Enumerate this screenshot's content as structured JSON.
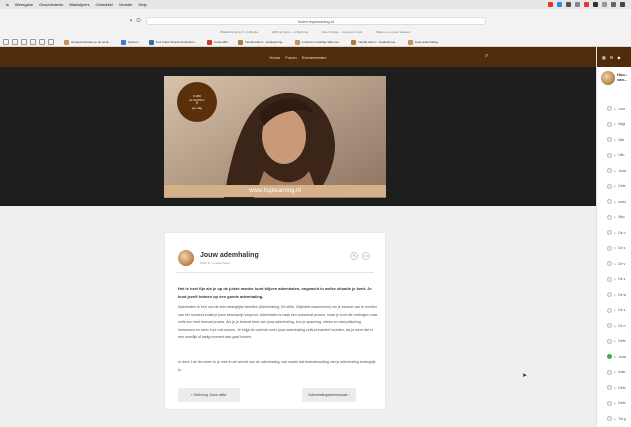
{
  "menubar": {
    "items": [
      "ls",
      "Weergave",
      "Geschiedenis",
      "Bladwijzers",
      "Ontwikkel",
      "Venster",
      "Help"
    ]
  },
  "browser": {
    "url": "leden.hsplearning.nl",
    "bookmarks": [
      "Bhaskil Ending, Fr Umbrella",
      "HRP-teit (Em. + & Buccina)",
      "Roun Starte ... ossed en hotel",
      "Taksen en, oroan takesen"
    ],
    "tabs": [
      "Hoogsensitiviteit op de werk...",
      "Openen",
      "Tool Class Simple Profession...",
      "ContentKit",
      "Yandat Admin - Hsplearning...",
      "mindvent metshaju Wits ber...",
      "Yandat Admin - Hsplearning...",
      "Jouw ademhaling"
    ]
  },
  "site": {
    "nav": [
      "Home",
      "Forum",
      "Evenementen"
    ],
    "hero_footer": "www.hsplearning.nl",
    "badge_line1": "6.000",
    "badge_line2": "tot 30.000 x",
    "badge_line3": "per dag"
  },
  "lesson": {
    "title": "Jouw ademhaling",
    "meta": "Shah 8 • in ademhalen",
    "lead": "Het is heel fijn als je op de juiste manier kunt blijven ademhalen, ongeacht in welke situatie je bent. Je kunt jezelf trainen op een goede ademhaling.",
    "para1": "Ademhalen is één van de drie belangrijke facetten (Ademhaling, De stilte, Objectief waarnemen) om je bewust van te worden van het moment zodat je jouw bewustzijn vergroot. Ademhalen is vaak een onbewust proces, maar je kunt die ombuigen naar zelfs een heel bewust proces. Als je je bewust bent van jouw ademhaling, kun je spanning, stress en overprikkeling herkennen en weer in je rust komen. Je krijgt de controle weer jouw ademhaling zelfs preventief inzetten, als je weet dat er een moeilijk of lastig moment aan gaat komen.",
    "para2": "In deze 1de les neem ik je mee in de wereld van de ademhaling, wat maakt dat bewustwording van je ademhaling belangrijk is.",
    "prev_label": "‹  Oefening 'Jouw stilte'",
    "next_label": "Ademhalingsleermiscast  ›"
  },
  "sidebar": {
    "course_title": "Hoo... van...",
    "items": [
      {
        "label": "Lere",
        "done": false
      },
      {
        "label": "Begi",
        "done": false
      },
      {
        "label": "Wat",
        "done": false
      },
      {
        "label": "Uitn",
        "done": false
      },
      {
        "label": "Jouw",
        "done": false
      },
      {
        "label": "Defe",
        "done": false
      },
      {
        "label": "mast",
        "done": false
      },
      {
        "label": "Mijn",
        "done": false
      },
      {
        "label": "De o",
        "done": false
      },
      {
        "label": "De s",
        "done": false
      },
      {
        "label": "De v",
        "done": false
      },
      {
        "label": "De s",
        "done": false
      },
      {
        "label": "De w",
        "done": false
      },
      {
        "label": "De s",
        "done": false
      },
      {
        "label": "De n",
        "done": false
      },
      {
        "label": "Defe",
        "done": false
      },
      {
        "label": "Jouw",
        "done": true
      },
      {
        "label": "Ader",
        "done": false
      },
      {
        "label": "Defe",
        "done": false
      },
      {
        "label": "Defe",
        "done": false
      },
      {
        "label": "Tot g",
        "done": false
      }
    ]
  },
  "colors": {
    "brand_dark": "#4f2c0a",
    "brand_light": "#d5b18a",
    "done_green": "#34b34a"
  }
}
